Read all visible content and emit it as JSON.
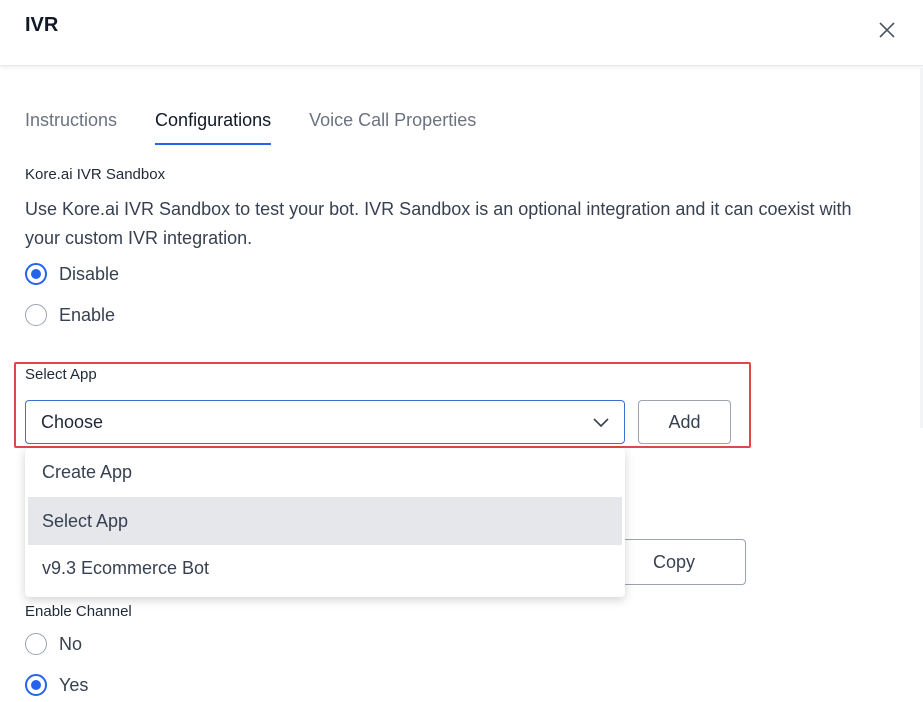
{
  "dialog": {
    "title": "IVR"
  },
  "tabs": [
    {
      "label": "Instructions",
      "active": false
    },
    {
      "label": "Configurations",
      "active": true
    },
    {
      "label": "Voice Call Properties",
      "active": false
    }
  ],
  "sandbox": {
    "label": "Kore.ai IVR Sandbox",
    "description": "Use Kore.ai IVR Sandbox to test your bot. IVR Sandbox is an optional integration and it can coexist with your custom IVR integration.",
    "options": [
      {
        "label": "Disable",
        "checked": true
      },
      {
        "label": "Enable",
        "checked": false
      }
    ]
  },
  "select_app": {
    "label": "Select App",
    "value": "Choose",
    "add_label": "Add",
    "dropdown_items": [
      "Create App",
      "Select App",
      "v9.3 Ecommerce Bot"
    ],
    "highlighted_item": "Select App"
  },
  "copy": {
    "label": "Copy"
  },
  "enable_channel": {
    "label": "Enable Channel",
    "options": [
      {
        "label": "No",
        "checked": false
      },
      {
        "label": "Yes",
        "checked": true
      }
    ]
  },
  "colors": {
    "accent": "#2563eb",
    "highlight_border": "#e04848"
  }
}
